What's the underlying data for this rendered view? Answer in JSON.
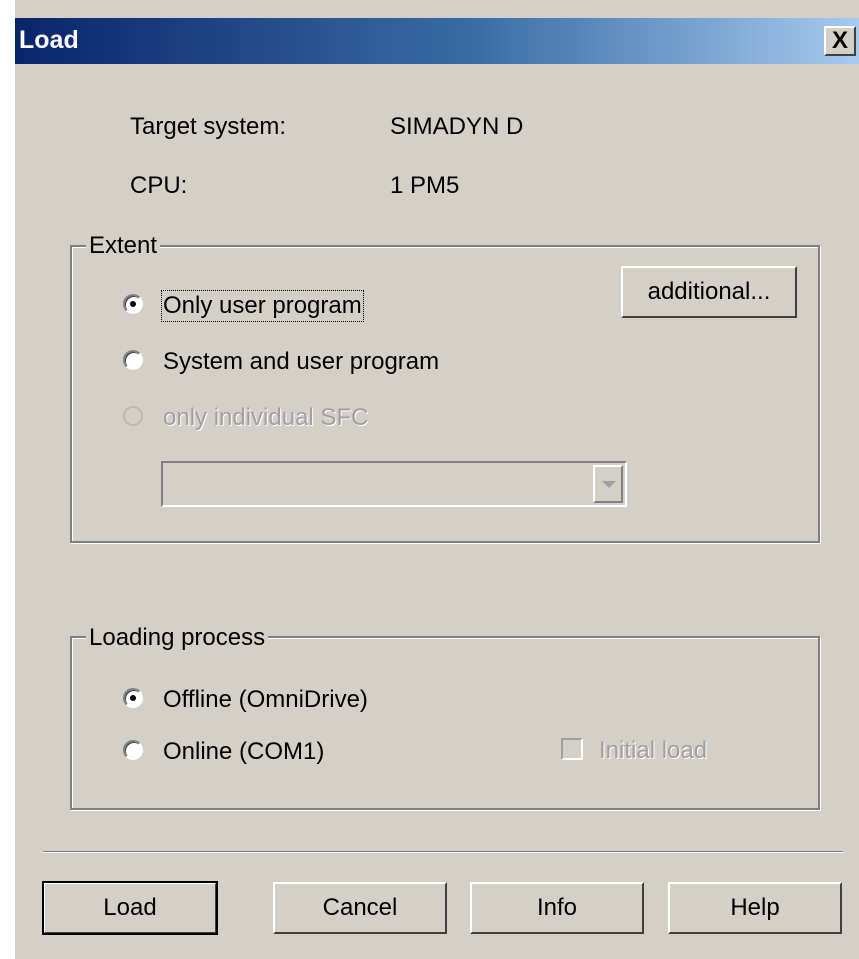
{
  "dialog": {
    "title": "Load",
    "close_label": "X"
  },
  "info": {
    "target_system_label": "Target system:",
    "target_system_value": "SIMADYN D",
    "cpu_label": "CPU:",
    "cpu_value": "1  PM5"
  },
  "extent": {
    "legend": "Extent",
    "additional_label": "additional...",
    "options": [
      {
        "label": "Only user program",
        "selected": true,
        "disabled": false
      },
      {
        "label": "System and user program",
        "selected": false,
        "disabled": false
      },
      {
        "label": "only individual SFC",
        "selected": false,
        "disabled": true
      }
    ],
    "sfc_select_value": ""
  },
  "loading": {
    "legend": "Loading process",
    "options": [
      {
        "label": "Offline (OmniDrive)",
        "selected": true
      },
      {
        "label": "Online (COM1)",
        "selected": false
      }
    ],
    "initial_load_label": "Initial load",
    "initial_load_checked": false,
    "initial_load_disabled": true
  },
  "buttons": {
    "load": "Load",
    "cancel": "Cancel",
    "info": "Info",
    "help": "Help"
  }
}
